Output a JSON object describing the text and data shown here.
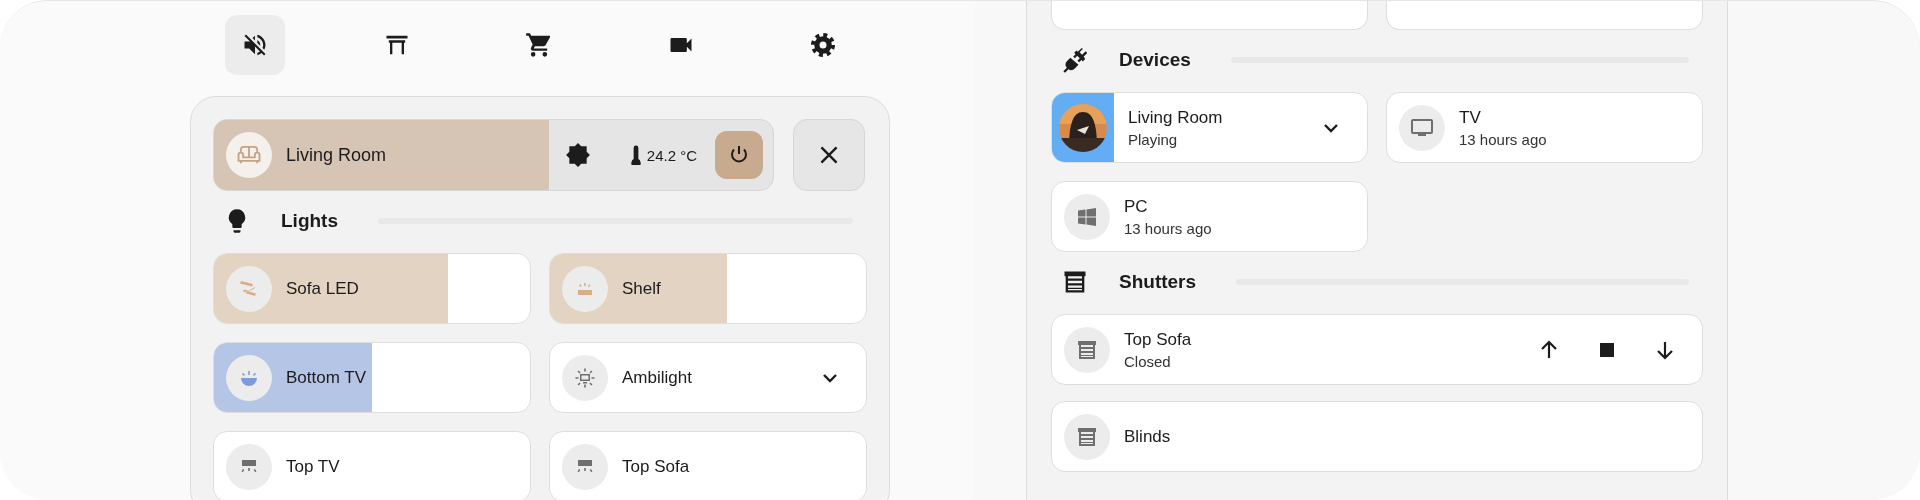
{
  "nav": [
    {
      "selected": true
    },
    {
      "selected": false
    },
    {
      "selected": false
    },
    {
      "selected": false
    },
    {
      "selected": false
    }
  ],
  "room": {
    "name": "Living Room",
    "level": 0.6,
    "temperature": "24.2 °C",
    "on": true
  },
  "lights": {
    "title": "Lights",
    "tiles": [
      {
        "name": "Sofa LED",
        "level": 0.74,
        "color": "#e3d3c3",
        "kind": "light"
      },
      {
        "name": "Shelf",
        "level": 0.56,
        "color": "#e3d3c3",
        "kind": "light"
      },
      {
        "name": "Bottom TV",
        "level": 0.5,
        "color": "#b5c5e5",
        "kind": "light"
      },
      {
        "name": "Ambilight",
        "kind": "expandable"
      },
      {
        "name": "Top TV",
        "kind": "light"
      },
      {
        "name": "Top Sofa",
        "kind": "light"
      }
    ]
  },
  "scrolled_tiles": [
    {
      "kind": "light"
    },
    {
      "kind": "light"
    }
  ],
  "devices": {
    "title": "Devices",
    "tiles": [
      {
        "name": "Living Room",
        "status": "Playing",
        "kind": "media",
        "expandable": true
      },
      {
        "name": "TV",
        "status": "13 hours ago",
        "kind": "device"
      },
      {
        "name": "PC",
        "status": "13 hours ago",
        "kind": "device"
      }
    ]
  },
  "shutters": {
    "title": "Shutters",
    "tiles": [
      {
        "name": "Top Sofa",
        "status": "Closed",
        "kind": "cover"
      },
      {
        "name": "Blinds",
        "kind": "cover"
      }
    ]
  }
}
